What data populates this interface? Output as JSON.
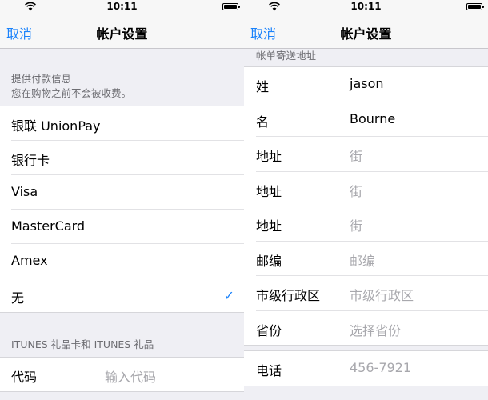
{
  "status": {
    "time": "10:11"
  },
  "nav": {
    "cancel_label": "取消",
    "title": "帐户设置"
  },
  "left": {
    "payment_header": {
      "title": "提供付款信息",
      "subtitle": "您在购物之前不会被收费。"
    },
    "payment_options": [
      {
        "label": "银联 UnionPay",
        "selected": false
      },
      {
        "label": "银行卡",
        "selected": false
      },
      {
        "label": "Visa",
        "selected": false
      },
      {
        "label": "MasterCard",
        "selected": false
      },
      {
        "label": "Amex",
        "selected": false
      },
      {
        "label": "无",
        "selected": true
      }
    ],
    "checkmark": "✓",
    "gift_header": "ITUNES 礼品卡和 ITUNES 礼品",
    "code_row": {
      "label": "代码",
      "placeholder": "输入代码"
    }
  },
  "right": {
    "billing_header": "帐单寄送地址",
    "fields": [
      {
        "label": "姓",
        "value": "jason",
        "placeholder": ""
      },
      {
        "label": "名",
        "value": "Bourne",
        "placeholder": ""
      },
      {
        "label": "地址",
        "value": "",
        "placeholder": "街"
      },
      {
        "label": "地址",
        "value": "",
        "placeholder": "街"
      },
      {
        "label": "地址",
        "value": "",
        "placeholder": "街"
      },
      {
        "label": "邮编",
        "value": "",
        "placeholder": "邮编"
      },
      {
        "label": "市级行政区",
        "value": "",
        "placeholder": "市级行政区"
      },
      {
        "label": "省份",
        "value": "",
        "placeholder": "选择省份"
      }
    ],
    "phone": {
      "label": "电话",
      "value": "",
      "placeholder": "456-7921"
    }
  },
  "colors": {
    "accent": "#1a82fb",
    "background": "#efeff4",
    "placeholder": "#a8a8ad",
    "secondary_text": "#6d6d72"
  }
}
